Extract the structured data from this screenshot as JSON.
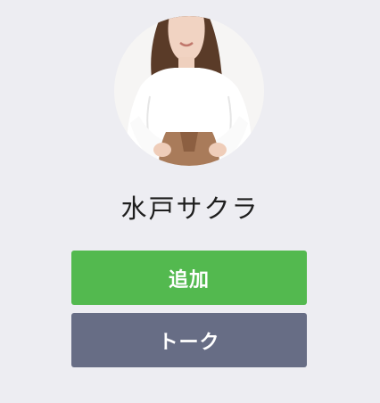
{
  "profile": {
    "display_name": "水戸サクラ",
    "avatar": "profile-photo"
  },
  "actions": {
    "add_label": "追加",
    "talk_label": "トーク"
  },
  "colors": {
    "background": "#EDEDF2",
    "add_button": "#53B94F",
    "talk_button": "#676D85",
    "button_text": "#FFFFFF"
  }
}
